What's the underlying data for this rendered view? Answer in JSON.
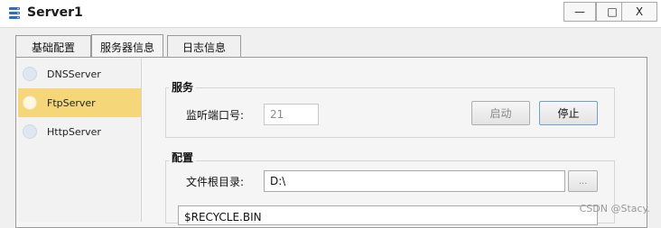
{
  "window": {
    "title": "Server1",
    "controls": {
      "minimize": "—",
      "maximize": "□",
      "close": "X"
    }
  },
  "tabs": [
    {
      "label": "基础配置",
      "active": false
    },
    {
      "label": "服务器信息",
      "active": true
    },
    {
      "label": "日志信息",
      "active": false
    }
  ],
  "servers": [
    {
      "label": "DNSServer",
      "selected": false
    },
    {
      "label": "FtpServer",
      "selected": true
    },
    {
      "label": "HttpServer",
      "selected": false
    }
  ],
  "service_group": {
    "title": "服务",
    "port_label": "监听端口号:",
    "port_value": "21",
    "start_label": "启动",
    "stop_label": "停止"
  },
  "config_group": {
    "title": "配置",
    "root_label": "文件根目录:",
    "root_value": "D:\\",
    "browse_label": "...",
    "files": [
      "$RECYCLE.BIN"
    ]
  },
  "watermark": "CSDN @Stacy.",
  "colors": {
    "selected_row": "#f5d77a",
    "primary_button_border": "#6f9ed1"
  }
}
